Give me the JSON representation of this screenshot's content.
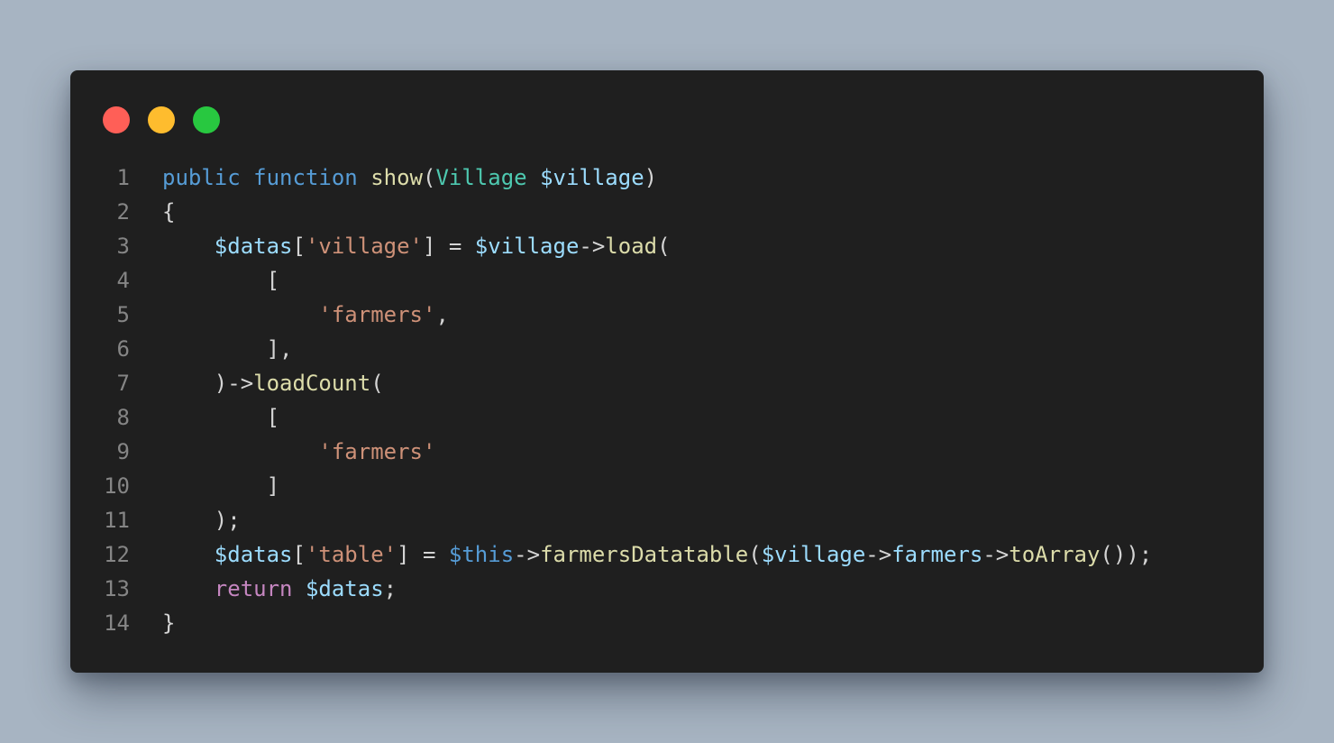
{
  "window": {
    "buttons": [
      {
        "name": "close",
        "color": "#ff5f57"
      },
      {
        "name": "minimize",
        "color": "#febc2e"
      },
      {
        "name": "maximize",
        "color": "#28c840"
      }
    ]
  },
  "code": {
    "lines": [
      {
        "num": "1",
        "tokens": [
          {
            "t": "public",
            "c": "kw"
          },
          {
            "t": " ",
            "c": "pun"
          },
          {
            "t": "function",
            "c": "kw"
          },
          {
            "t": " ",
            "c": "pun"
          },
          {
            "t": "show",
            "c": "fn"
          },
          {
            "t": "(",
            "c": "pun"
          },
          {
            "t": "Village",
            "c": "type"
          },
          {
            "t": " ",
            "c": "pun"
          },
          {
            "t": "$village",
            "c": "var"
          },
          {
            "t": ")",
            "c": "pun"
          }
        ]
      },
      {
        "num": "2",
        "tokens": [
          {
            "t": "{",
            "c": "pun"
          }
        ]
      },
      {
        "num": "3",
        "tokens": [
          {
            "t": "    ",
            "c": "pun"
          },
          {
            "t": "$datas",
            "c": "var"
          },
          {
            "t": "[",
            "c": "pun"
          },
          {
            "t": "'village'",
            "c": "str"
          },
          {
            "t": "] = ",
            "c": "pun"
          },
          {
            "t": "$village",
            "c": "var"
          },
          {
            "t": "->",
            "c": "pun"
          },
          {
            "t": "load",
            "c": "fn"
          },
          {
            "t": "(",
            "c": "pun"
          }
        ]
      },
      {
        "num": "4",
        "tokens": [
          {
            "t": "        [",
            "c": "pun"
          }
        ]
      },
      {
        "num": "5",
        "tokens": [
          {
            "t": "            ",
            "c": "pun"
          },
          {
            "t": "'farmers'",
            "c": "str"
          },
          {
            "t": ",",
            "c": "pun"
          }
        ]
      },
      {
        "num": "6",
        "tokens": [
          {
            "t": "        ],",
            "c": "pun"
          }
        ]
      },
      {
        "num": "7",
        "tokens": [
          {
            "t": "    )->",
            "c": "pun"
          },
          {
            "t": "loadCount",
            "c": "fn"
          },
          {
            "t": "(",
            "c": "pun"
          }
        ]
      },
      {
        "num": "8",
        "tokens": [
          {
            "t": "        [",
            "c": "pun"
          }
        ]
      },
      {
        "num": "9",
        "tokens": [
          {
            "t": "            ",
            "c": "pun"
          },
          {
            "t": "'farmers'",
            "c": "str"
          }
        ]
      },
      {
        "num": "10",
        "tokens": [
          {
            "t": "        ]",
            "c": "pun"
          }
        ]
      },
      {
        "num": "11",
        "tokens": [
          {
            "t": "    );",
            "c": "pun"
          }
        ]
      },
      {
        "num": "12",
        "tokens": [
          {
            "t": "    ",
            "c": "pun"
          },
          {
            "t": "$datas",
            "c": "var"
          },
          {
            "t": "[",
            "c": "pun"
          },
          {
            "t": "'table'",
            "c": "str"
          },
          {
            "t": "] = ",
            "c": "pun"
          },
          {
            "t": "$this",
            "c": "kw"
          },
          {
            "t": "->",
            "c": "pun"
          },
          {
            "t": "farmersDatatable",
            "c": "fn"
          },
          {
            "t": "(",
            "c": "pun"
          },
          {
            "t": "$village",
            "c": "var"
          },
          {
            "t": "->",
            "c": "pun"
          },
          {
            "t": "farmers",
            "c": "var"
          },
          {
            "t": "->",
            "c": "pun"
          },
          {
            "t": "toArray",
            "c": "fn"
          },
          {
            "t": "());",
            "c": "pun"
          }
        ]
      },
      {
        "num": "13",
        "tokens": [
          {
            "t": "    ",
            "c": "pun"
          },
          {
            "t": "return",
            "c": "ctl"
          },
          {
            "t": " ",
            "c": "pun"
          },
          {
            "t": "$datas",
            "c": "var"
          },
          {
            "t": ";",
            "c": "pun"
          }
        ]
      },
      {
        "num": "14",
        "tokens": [
          {
            "t": "}",
            "c": "pun"
          }
        ]
      }
    ]
  }
}
